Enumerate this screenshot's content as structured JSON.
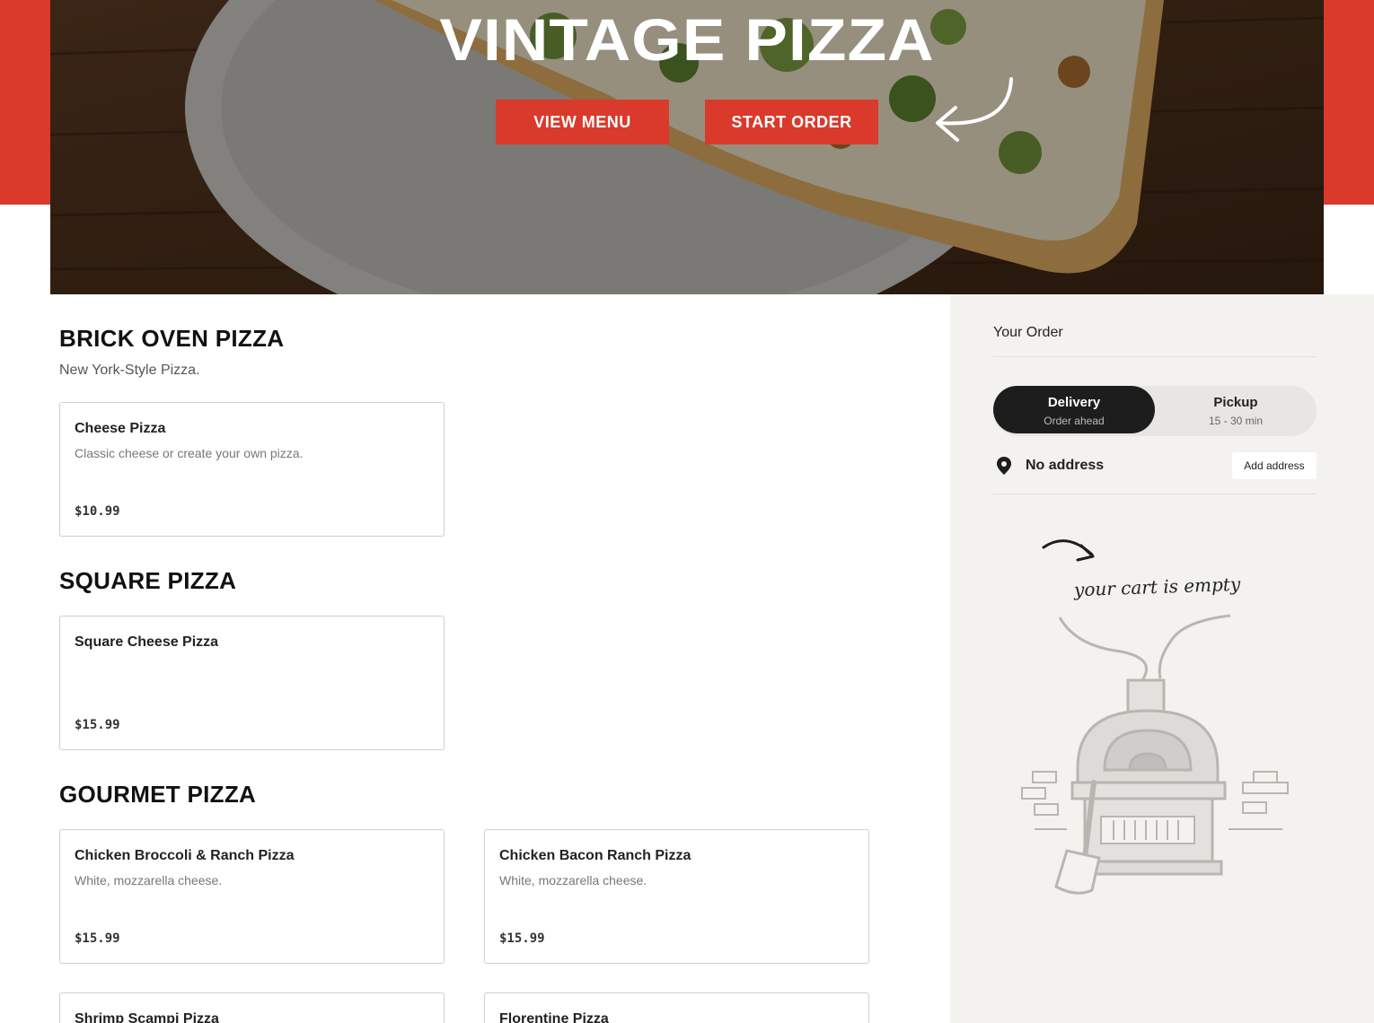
{
  "hero": {
    "title": "VINTAGE PIZZA",
    "view_menu": "VIEW MENU",
    "start_order": "START ORDER"
  },
  "colors": {
    "brand_red": "#d93a2b",
    "dark": "#1d1d1d",
    "sidebar_bg": "#f3f2ef"
  },
  "sections": [
    {
      "title": "BRICK OVEN PIZZA",
      "subtitle": "New York-Style Pizza.",
      "items": [
        {
          "name": "Cheese Pizza",
          "desc": "Classic cheese or create your own pizza.",
          "price": "$10.99"
        }
      ]
    },
    {
      "title": "SQUARE PIZZA",
      "items": [
        {
          "name": "Square Cheese Pizza",
          "desc": "",
          "price": "$15.99"
        }
      ]
    },
    {
      "title": "GOURMET PIZZA",
      "items": [
        {
          "name": "Chicken Broccoli & Ranch Pizza",
          "desc": "White, mozzarella cheese.",
          "price": "$15.99"
        },
        {
          "name": "Chicken Bacon Ranch Pizza",
          "desc": "White, mozzarella cheese.",
          "price": "$15.99"
        },
        {
          "name": "Shrimp Scampi Pizza"
        },
        {
          "name": "Florentine Pizza"
        }
      ]
    }
  ],
  "order": {
    "title": "Your Order",
    "delivery": {
      "label": "Delivery",
      "sub": "Order ahead"
    },
    "pickup": {
      "label": "Pickup",
      "sub": "15 - 30 min"
    },
    "address": "No address",
    "add_address": "Add address",
    "empty_cart": "your cart is empty",
    "icons": [
      "location-pin-icon",
      "curved-arrow-icon",
      "pizza-oven-illustration"
    ]
  }
}
